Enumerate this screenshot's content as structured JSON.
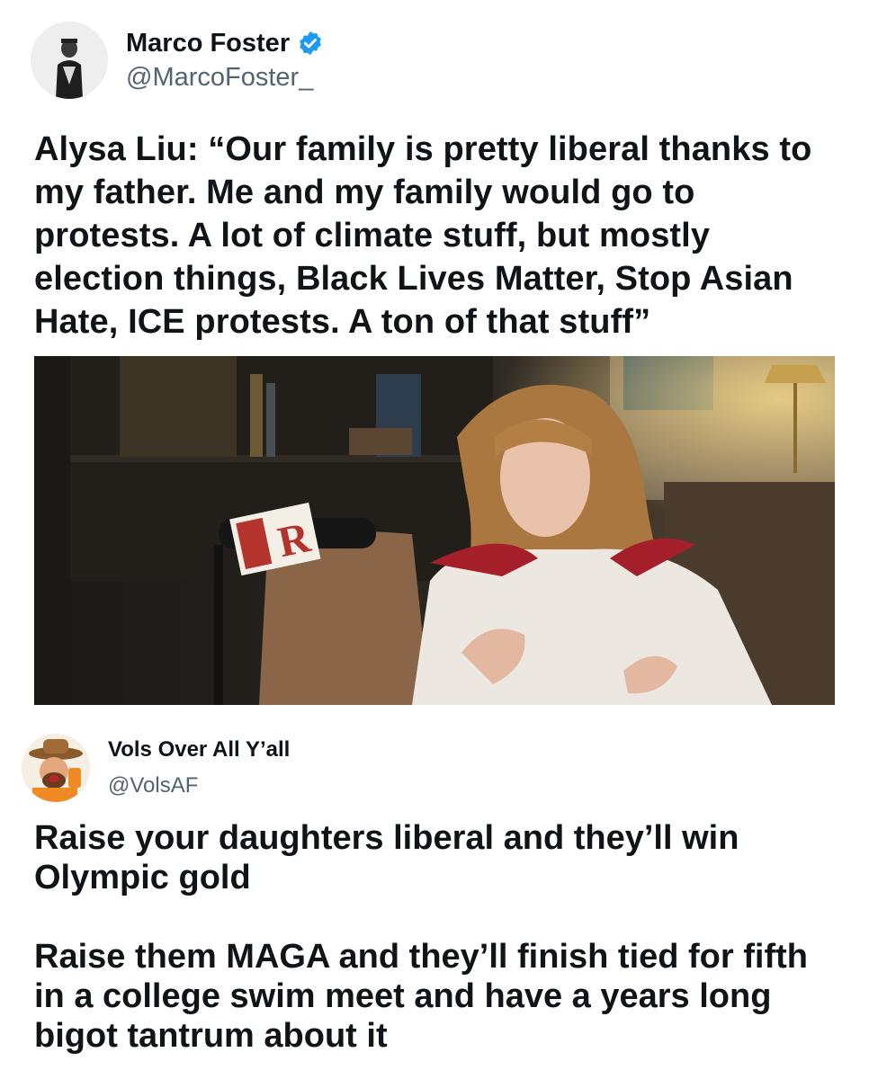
{
  "tweet1": {
    "display_name": "Marco Foster",
    "handle": "@MarcoFoster_",
    "verified_icon": "verified-badge-icon",
    "text": "Alysa Liu: “Our family is pretty liberal thanks to my father. Me and my family would go to protests. A lot of climate stuff, but mostly election things, Black Lives Matter, Stop Asian Hate, ICE protests. A ton of that stuff”",
    "media": {
      "mic_flag_letter": "R"
    }
  },
  "tweet2": {
    "display_name": "Vols Over All Y’all",
    "handle": "@VolsAF",
    "paragraphs": [
      "Raise your daughters liberal and they’ll win Olympic gold",
      "Raise them MAGA and they’ll finish tied for fifth in a college swim meet and have a years long bigot tantrum about it"
    ]
  },
  "colors": {
    "verified_blue": "#1d9bf0",
    "handle_gray": "#536471",
    "text": "#0f1419"
  }
}
